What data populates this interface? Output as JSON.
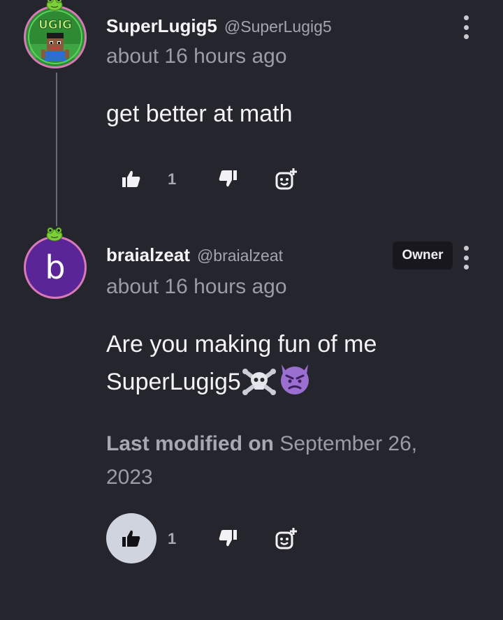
{
  "comments": [
    {
      "username": "SuperLugig5",
      "handle": "@SuperLugig5",
      "timestamp": "about 16 hours ago",
      "body": "get better at math",
      "avatar_text": "UGIG",
      "likes": "1",
      "like_active": false
    },
    {
      "username": "braialzeat",
      "handle": "@braialzeat",
      "badge": "Owner",
      "timestamp": "about 16 hours ago",
      "body_line1": "Are you making fun of me",
      "body_line2": "SuperLugig5",
      "body_emojis": [
        "skull-crossbones-icon",
        "angry-devil-icon"
      ],
      "avatar_letter": "b",
      "modified_label": "Last modified on",
      "modified_date": "September 26, 2023",
      "likes": "1",
      "like_active": true
    }
  ],
  "icons": {
    "like": "thumbs-up-icon",
    "dislike": "thumbs-down-icon",
    "react": "add-reaction-icon",
    "more": "more-vertical-icon",
    "badge": "frog-icon"
  },
  "colors": {
    "background": "#25252e",
    "avatar_ring": "#d77ab7",
    "letter_avatar": "#5a2597",
    "active_like": "#cfd4df",
    "owner_badge": "#17171d"
  }
}
